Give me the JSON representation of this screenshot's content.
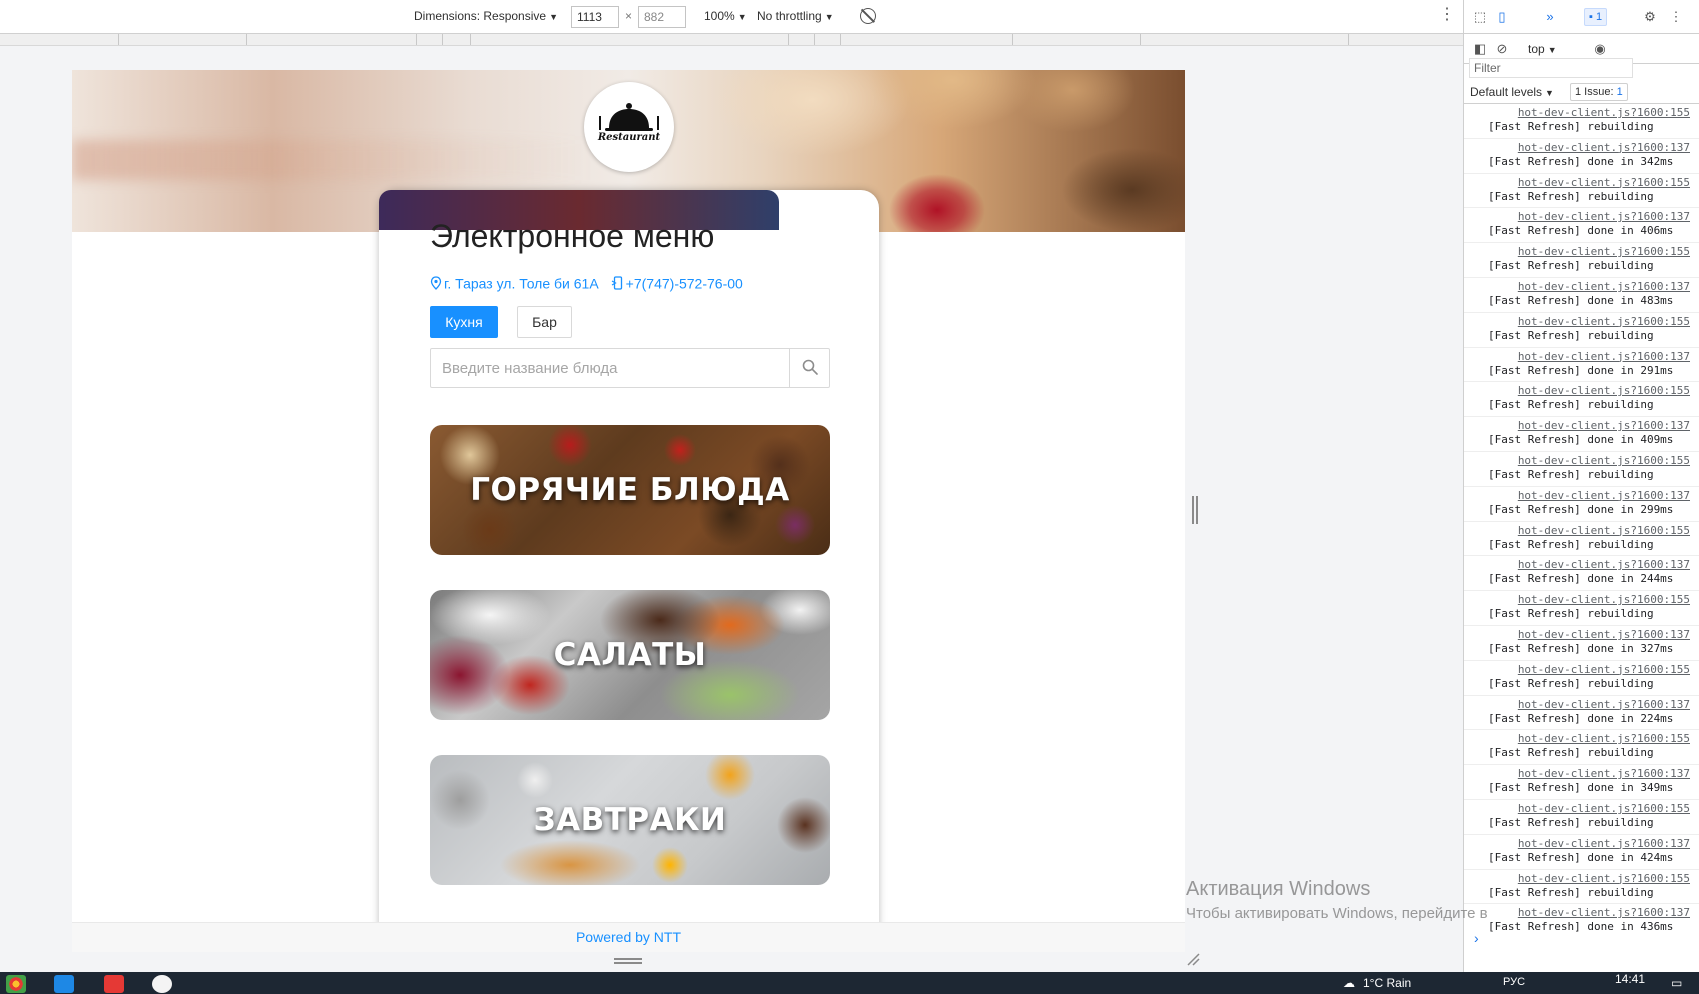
{
  "device_toolbar": {
    "dimensions_label": "Dimensions: Responsive",
    "width": "1113",
    "height": "882",
    "zoom": "100%",
    "throttling": "No throttling"
  },
  "site": {
    "logo_text": "Restaurant",
    "title": "Электронное меню",
    "address": "г. Тараз ул. Толе би 61А",
    "phone": "+7(747)-572-76-00",
    "tabs": [
      "Кухня",
      "Бар"
    ],
    "active_tab": "Кухня",
    "search_placeholder": "Введите название блюда",
    "categories": [
      "ГОРЯЧИЕ БЛЮДА",
      "САЛАТЫ",
      "ЗАВТРАКИ"
    ],
    "footer": "Powered by NTT"
  },
  "watermark": {
    "title": "Активация Windows",
    "subtitle": "Чтобы активировать Windows, перейдите в"
  },
  "devtools": {
    "issues_count": "1",
    "context": "top",
    "filter_placeholder": "Filter",
    "levels": "Default levels",
    "issues_label": "1 Issue:",
    "issues_badge": "1",
    "log": [
      {
        "src": "hot-dev-client.js?1600:155",
        "msg": "[Fast Refresh] rebuilding"
      },
      {
        "src": "hot-dev-client.js?1600:137",
        "msg": "[Fast Refresh] done in 342ms"
      },
      {
        "src": "hot-dev-client.js?1600:155",
        "msg": "[Fast Refresh] rebuilding"
      },
      {
        "src": "hot-dev-client.js?1600:137",
        "msg": "[Fast Refresh] done in 406ms"
      },
      {
        "src": "hot-dev-client.js?1600:155",
        "msg": "[Fast Refresh] rebuilding"
      },
      {
        "src": "hot-dev-client.js?1600:137",
        "msg": "[Fast Refresh] done in 483ms"
      },
      {
        "src": "hot-dev-client.js?1600:155",
        "msg": "[Fast Refresh] rebuilding"
      },
      {
        "src": "hot-dev-client.js?1600:137",
        "msg": "[Fast Refresh] done in 291ms"
      },
      {
        "src": "hot-dev-client.js?1600:155",
        "msg": "[Fast Refresh] rebuilding"
      },
      {
        "src": "hot-dev-client.js?1600:137",
        "msg": "[Fast Refresh] done in 409ms"
      },
      {
        "src": "hot-dev-client.js?1600:155",
        "msg": "[Fast Refresh] rebuilding"
      },
      {
        "src": "hot-dev-client.js?1600:137",
        "msg": "[Fast Refresh] done in 299ms"
      },
      {
        "src": "hot-dev-client.js?1600:155",
        "msg": "[Fast Refresh] rebuilding"
      },
      {
        "src": "hot-dev-client.js?1600:137",
        "msg": "[Fast Refresh] done in 244ms"
      },
      {
        "src": "hot-dev-client.js?1600:155",
        "msg": "[Fast Refresh] rebuilding"
      },
      {
        "src": "hot-dev-client.js?1600:137",
        "msg": "[Fast Refresh] done in 327ms"
      },
      {
        "src": "hot-dev-client.js?1600:155",
        "msg": "[Fast Refresh] rebuilding"
      },
      {
        "src": "hot-dev-client.js?1600:137",
        "msg": "[Fast Refresh] done in 224ms"
      },
      {
        "src": "hot-dev-client.js?1600:155",
        "msg": "[Fast Refresh] rebuilding"
      },
      {
        "src": "hot-dev-client.js?1600:137",
        "msg": "[Fast Refresh] done in 349ms"
      },
      {
        "src": "hot-dev-client.js?1600:155",
        "msg": "[Fast Refresh] rebuilding"
      },
      {
        "src": "hot-dev-client.js?1600:137",
        "msg": "[Fast Refresh] done in 424ms"
      },
      {
        "src": "hot-dev-client.js?1600:155",
        "msg": "[Fast Refresh] rebuilding"
      },
      {
        "src": "hot-dev-client.js?1600:137",
        "msg": "[Fast Refresh] done in 436ms"
      }
    ]
  },
  "taskbar": {
    "weather": "1°C  Rain",
    "language": "РУС",
    "time": "14:41"
  },
  "colors": {
    "accent": "#1890ff",
    "taskbar": "#1d2733"
  }
}
